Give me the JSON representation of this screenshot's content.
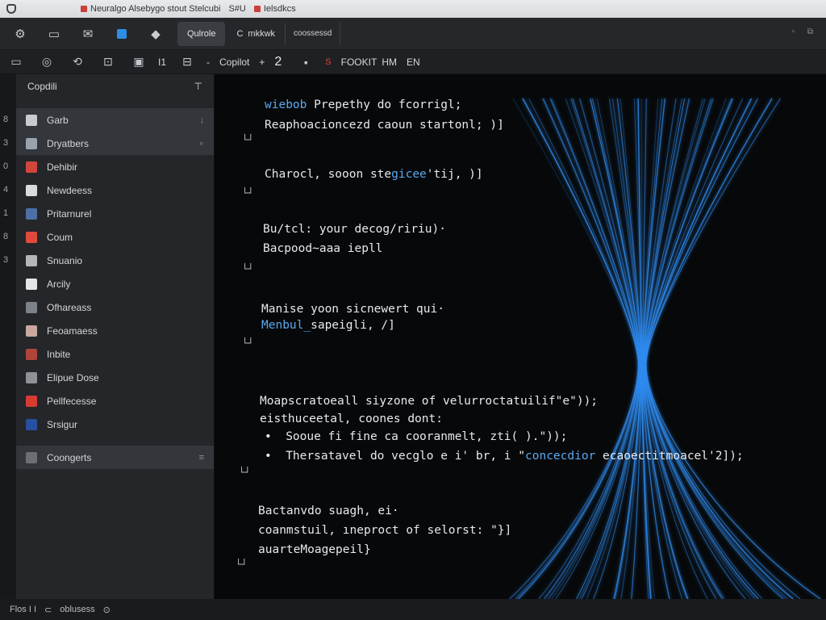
{
  "browser": {
    "tabs": [
      {
        "label": "Neuralgo Alsebygo stout Stelcubi"
      },
      {
        "label": "S#U"
      },
      {
        "label": "Ielsdkcs"
      }
    ]
  },
  "topbar": {
    "active_tab": "Qulrole",
    "c_label": "C",
    "c_sub": "mkkwk",
    "second_tab": "coossessd"
  },
  "toolbar": {
    "divider_text": "I1",
    "dash": "-",
    "copilot_label": "Copilot",
    "plus": "+",
    "number": "2",
    "red_mark": "S",
    "format_label": "FOOKIT",
    "hm_label": "HM",
    "en_label": "EN"
  },
  "gutter": [
    "8",
    "3",
    "0",
    "4",
    "1",
    "8",
    "3"
  ],
  "sidebar": {
    "header": "Copdili",
    "pin": "⊤",
    "items": [
      {
        "label": "Garb",
        "trail": "↓",
        "color": "#c8cacd",
        "active": true
      },
      {
        "label": "Dryatbers",
        "trail": "∘",
        "color": "#9aa3ad",
        "active": true
      },
      {
        "label": "Dehibir",
        "trail": "",
        "color": "#d0463b"
      },
      {
        "label": "Newdeess",
        "trail": "",
        "color": "#d9dbde"
      },
      {
        "label": "Pritarnurel",
        "trail": "",
        "color": "#4c6fa5"
      },
      {
        "label": "Coum",
        "trail": "",
        "color": "#e04a3c"
      },
      {
        "label": "Snuanio",
        "trail": "",
        "color": "#b4b7ba"
      },
      {
        "label": "Arcily",
        "trail": "",
        "color": "#e4e5e7"
      },
      {
        "label": "Ofhareass",
        "trail": "",
        "color": "#7c8288"
      },
      {
        "label": "Feoamaess",
        "trail": "",
        "color": "#c9a79f"
      },
      {
        "label": "Inbite",
        "trail": "",
        "color": "#b0443a"
      },
      {
        "label": "Elipue Dose",
        "trail": "",
        "color": "#8e9296"
      },
      {
        "label": "Pellfecesse",
        "trail": "",
        "color": "#d73c32"
      },
      {
        "label": "Srsigur",
        "trail": "",
        "color": "#2a4fa0"
      }
    ],
    "bottom_item": {
      "label": "Coongerts",
      "trail": "≡"
    }
  },
  "editor": {
    "lines": [
      {
        "kw": "wiebob",
        "text": " Prepethy do fcorrigl;"
      },
      {
        "kw": "",
        "text": "Reaphoacioncezd caoun startonl; )]"
      },
      {
        "kw": "",
        "text": "Charocl, sooon ste",
        "kw2": "gicee",
        "tail": "'tij, )]"
      },
      {
        "kw": "",
        "text": "Bu/tcl: your decog/ririu)·"
      },
      {
        "kw": "",
        "text": "Bacpood~aaa iepll"
      },
      {
        "kw": "",
        "text": "Manise yoon sicnewert qui·"
      },
      {
        "kw": "Menbul_",
        "text": "sapeigli, /]"
      },
      {
        "kw": "",
        "text": "Moapscratoeall siyzone of velurroctatuilif\"e\"));"
      },
      {
        "kw": "",
        "text": "eisthuceetal, coones dont:"
      },
      {
        "kw": "",
        "text": "•  Sooue fi fine ca cooranmelt, zti( ).\"));"
      },
      {
        "kw": "",
        "text": "•  Thersatavel do vecglo e i' br, i \"",
        "kw2": "concecdior",
        "tail": " ecaoectitmoacel'2]);"
      },
      {
        "kw": "",
        "text": "Bactanvdo suagh, ei·"
      },
      {
        "kw": "",
        "text": "coanmstuil, ıneproct of selorst: \"}]"
      },
      {
        "kw": "",
        "text": "auarteMoagepeil}"
      }
    ],
    "fold_marker": "└┘",
    "fiber_color": "#2f8cf0"
  },
  "statusbar": {
    "left": "Flos I I",
    "mid_icon": "⊂",
    "mid_text": "oblusess",
    "right_icon": "⊙"
  }
}
